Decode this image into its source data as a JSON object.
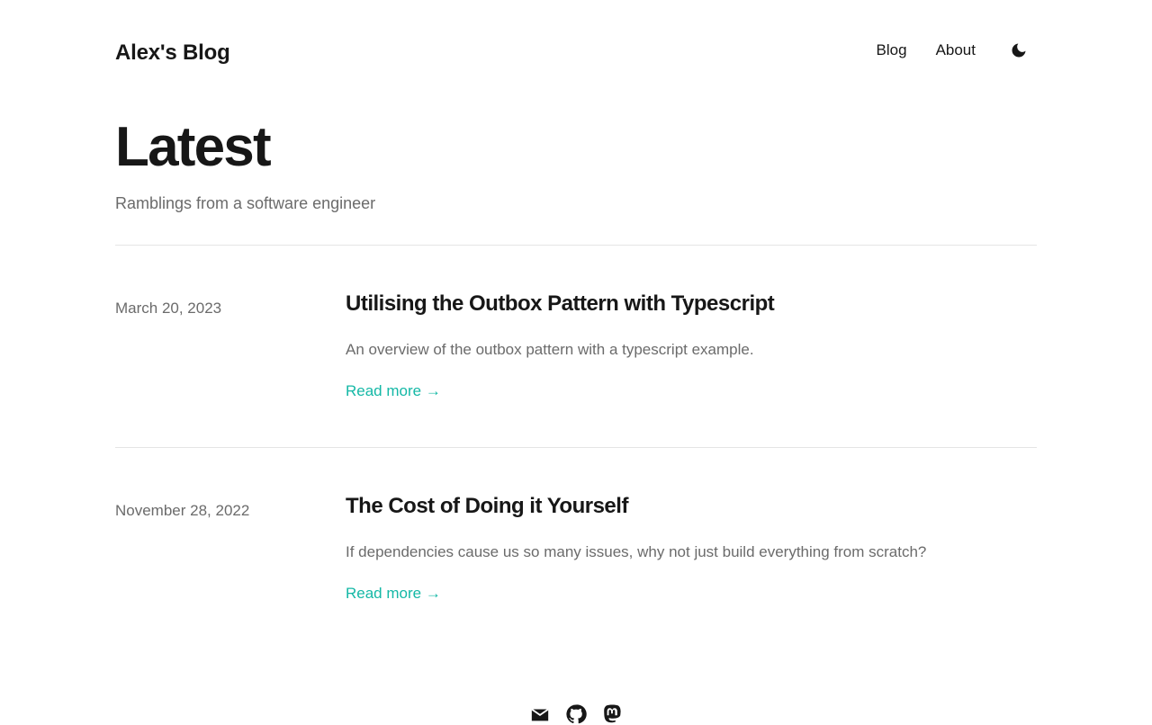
{
  "header": {
    "site_title": "Alex's Blog",
    "nav": {
      "blog": "Blog",
      "about": "About"
    },
    "theme_toggle_icon": "moon-icon"
  },
  "hero": {
    "title": "Latest",
    "subtitle": "Ramblings from a software engineer"
  },
  "posts": [
    {
      "date": "March 20, 2023",
      "title": "Utilising the Outbox Pattern with Typescript",
      "summary": "An overview of the outbox pattern with a typescript example.",
      "read_more": "Read more →"
    },
    {
      "date": "November 28, 2022",
      "title": "The Cost of Doing it Yourself",
      "summary": "If dependencies cause us so many issues, why not just build everything from scratch?",
      "read_more": "Read more →"
    }
  ],
  "footer": {
    "icons": [
      "mail-icon",
      "github-icon",
      "mastodon-icon"
    ]
  },
  "colors": {
    "text": "#171717",
    "muted": "#6b6b6b",
    "accent": "#14b8a6",
    "divider": "#e5e5e5"
  }
}
